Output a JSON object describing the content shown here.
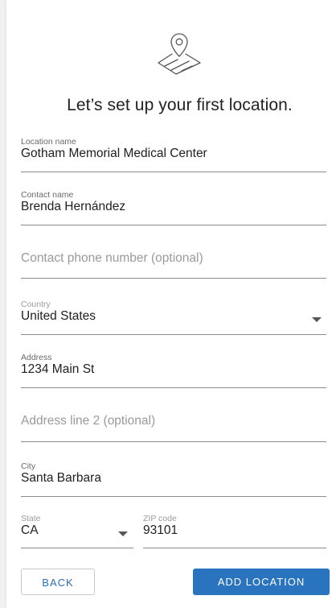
{
  "heading": "Let’s set up your first location.",
  "location_name": {
    "label": "Location name",
    "value": "Gotham Memorial Medical Center"
  },
  "contact_name": {
    "label": "Contact name",
    "value": "Brenda Hernández"
  },
  "contact_phone": {
    "placeholder": "Contact phone number (optional)"
  },
  "country": {
    "label": "Country",
    "value": "United States"
  },
  "address": {
    "label": "Address",
    "value": "1234 Main St"
  },
  "address2": {
    "placeholder": "Address line 2 (optional)"
  },
  "city": {
    "label": "City",
    "value": "Santa Barbara"
  },
  "state": {
    "label": "State",
    "value": "CA"
  },
  "zip": {
    "label": "ZIP code",
    "value": "93101"
  },
  "buttons": {
    "back": "BACK",
    "add": "ADD LOCATION"
  },
  "colors": {
    "accent": "#2a73bf",
    "accent_text": "#2a6fb4"
  },
  "icons": [
    "map-pin-icon",
    "dropdown-caret-icon"
  ]
}
